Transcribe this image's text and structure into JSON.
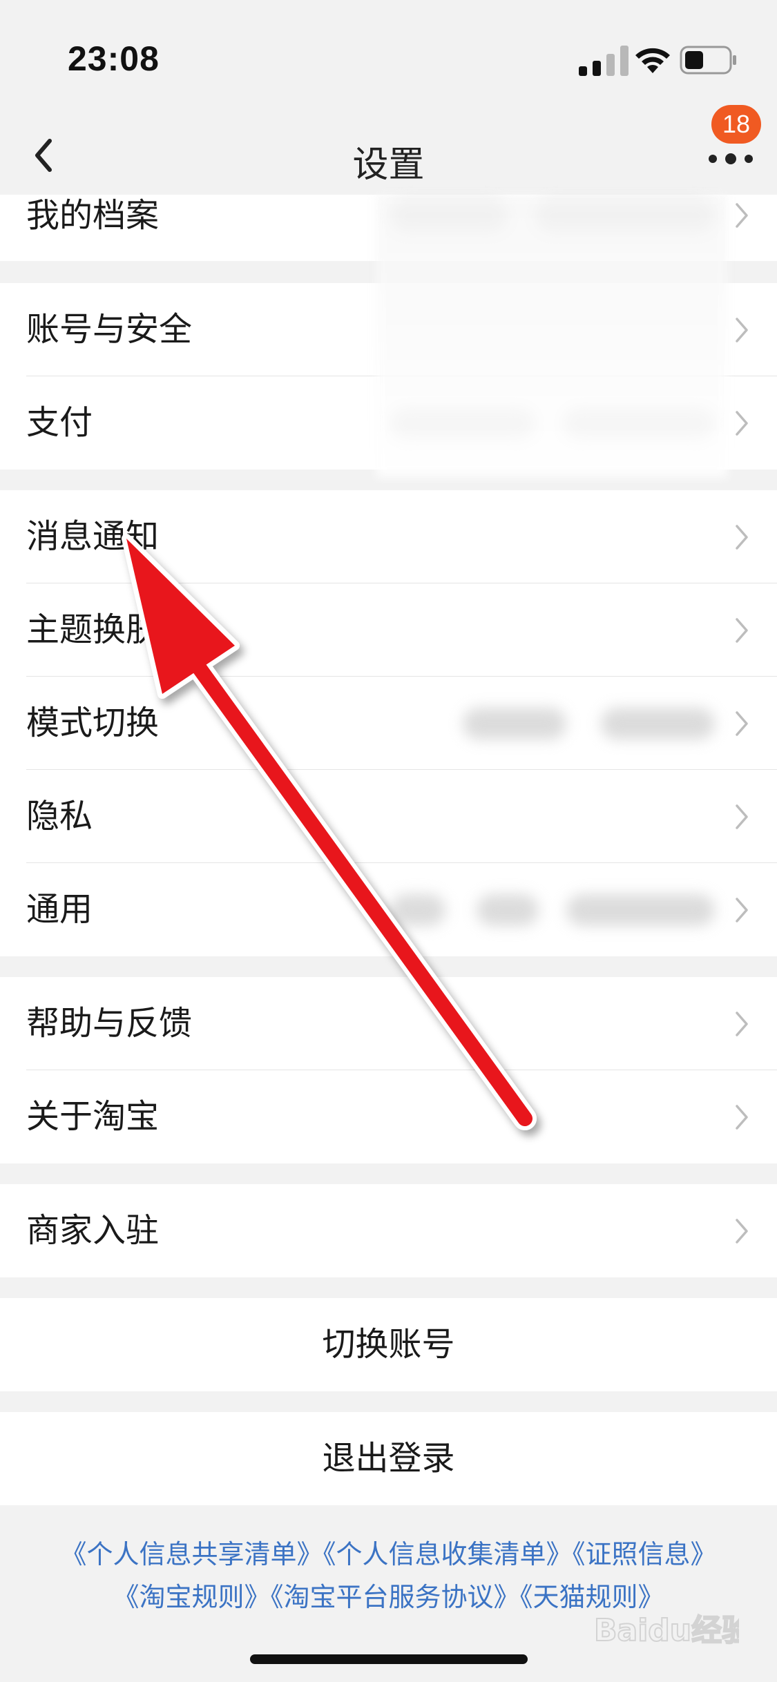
{
  "status_bar": {
    "time": "23:08",
    "icons": [
      "cellular-signal-icon",
      "wifi-icon",
      "battery-icon"
    ]
  },
  "nav": {
    "title": "设置",
    "back_icon": "chevron-left-icon",
    "more_icon": "more-dots-icon",
    "badge_count": "18"
  },
  "groups": [
    {
      "items": [
        {
          "label": "我的档案"
        }
      ]
    },
    {
      "items": [
        {
          "label": "账号与安全"
        },
        {
          "label": "支付"
        }
      ]
    },
    {
      "items": [
        {
          "label": "消息通知"
        },
        {
          "label": "主题换肤"
        },
        {
          "label": "模式切换"
        },
        {
          "label": "隐私"
        },
        {
          "label": "通用"
        }
      ]
    },
    {
      "items": [
        {
          "label": "帮助与反馈"
        },
        {
          "label": "关于淘宝"
        }
      ]
    },
    {
      "items": [
        {
          "label": "商家入驻"
        }
      ]
    }
  ],
  "actions": {
    "switch_account": "切换账号",
    "logout": "退出登录"
  },
  "footer_links": {
    "line1": [
      "《个人信息共享清单》",
      "《个人信息收集清单》",
      "《证照信息》"
    ],
    "line2": [
      "《淘宝规则》",
      "《淘宝平台服务协议》",
      "《天猫规则》"
    ]
  },
  "watermark": "Baidu经验",
  "colors": {
    "badge": "#f05a22",
    "link": "#3b73c4",
    "annotation_arrow": "#e8141c",
    "background": "#f2f2f2"
  }
}
